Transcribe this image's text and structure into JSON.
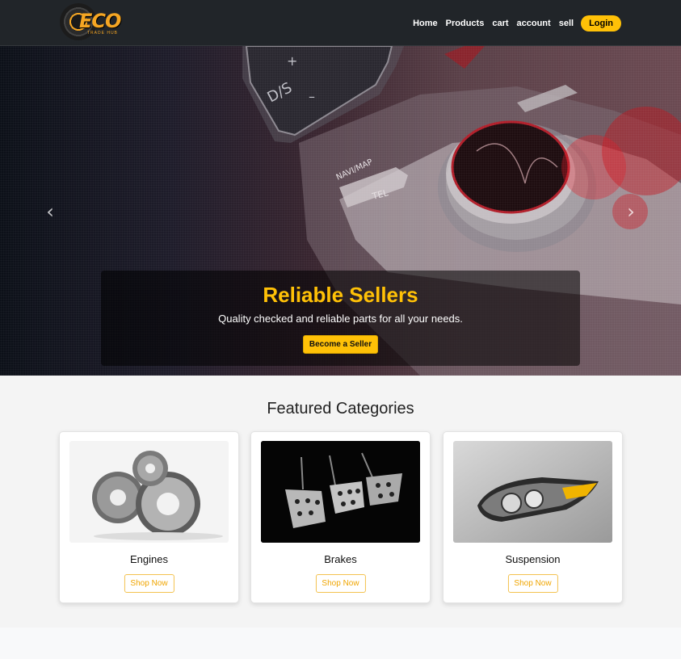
{
  "brand": {
    "name": "ECO",
    "tagline": "TRADE HUB",
    "accent": "#ffc107"
  },
  "nav": {
    "links": [
      "Home",
      "Products",
      "cart",
      "account",
      "sell"
    ],
    "login_label": "Login"
  },
  "hero": {
    "title": "Reliable Sellers",
    "text": "Quality checked and reliable parts for all your needs.",
    "button_label": "Become a Seller",
    "prev_icon": "chevron-left-icon",
    "next_icon": "chevron-right-icon"
  },
  "featured": {
    "title": "Featured Categories",
    "cards": [
      {
        "name": "Engines",
        "button": "Shop Now",
        "image": "gears-photo"
      },
      {
        "name": "Brakes",
        "button": "Shop Now",
        "image": "pedals-photo"
      },
      {
        "name": "Suspension",
        "button": "Shop Now",
        "image": "headlight-photo"
      }
    ]
  }
}
